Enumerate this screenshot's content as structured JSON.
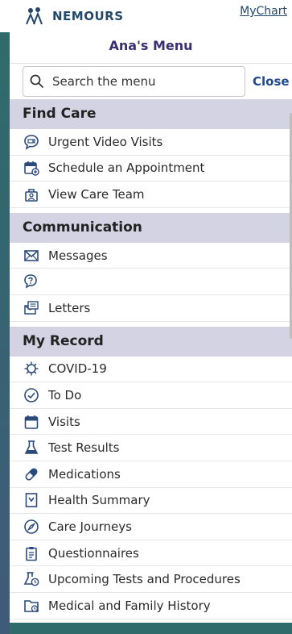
{
  "header": {
    "logo_text": "NEMOURS",
    "mychart_link": "MyChart"
  },
  "menu": {
    "title": "Ana's Menu",
    "search_placeholder": "Search the menu",
    "close_label": "Close"
  },
  "sections": {
    "find_care": {
      "title": "Find Care",
      "items": [
        "Urgent Video Visits",
        "Schedule an Appointment",
        "View Care Team"
      ]
    },
    "communication": {
      "title": "Communication",
      "items": [
        "Messages",
        "",
        "Letters"
      ]
    },
    "my_record": {
      "title": "My Record",
      "items": [
        "COVID-19",
        "To Do",
        "Visits",
        "Test Results",
        "Medications",
        "Health Summary",
        "Care Journeys",
        "Questionnaires",
        "Upcoming Tests and Procedures",
        "Medical and Family History"
      ]
    }
  },
  "colors": {
    "brand_navy": "#23486a",
    "menu_title": "#3b2f73",
    "section_bg": "#d3d3e3",
    "close_link": "#1f4b8f",
    "icon_blue": "#2a4a7a"
  }
}
